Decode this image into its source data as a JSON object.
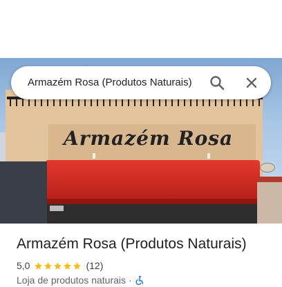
{
  "search": {
    "query": "Armazém Rosa (Produtos Naturais)"
  },
  "photo": {
    "sign_text": "Armazém Rosa"
  },
  "place": {
    "name": "Armazém Rosa (Produtos Naturais)",
    "rating": "5,0",
    "stars": 5,
    "review_count": "(12)",
    "category": "Loja de produtos naturais",
    "separator": "·"
  },
  "icons": {
    "search": "search-icon",
    "close": "close-icon",
    "star": "star-icon",
    "accessibility": "wheelchair-icon"
  },
  "colors": {
    "star": "#fbbc04",
    "accent": "#1a73e8"
  }
}
